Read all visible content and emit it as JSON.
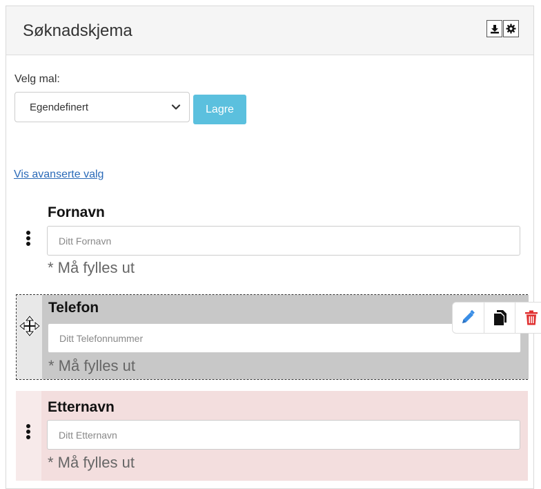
{
  "header": {
    "title": "Søknadskjema",
    "download_icon": "download-icon",
    "settings_icon": "gear-icon"
  },
  "template": {
    "label": "Velg mal:",
    "selected": "Egendefinert",
    "save_label": "Lagre"
  },
  "advanced_link": "Vis avanserte valg",
  "fields": [
    {
      "label": "Fornavn",
      "placeholder": "Ditt Fornavn",
      "required_text": "* Må fylles ut",
      "state": "normal"
    },
    {
      "label": "Telefon",
      "placeholder": "Ditt Telefonnummer",
      "required_text": "* Må fylles ut",
      "state": "dragging"
    },
    {
      "label": "Etternavn",
      "placeholder": "Ditt Etternavn",
      "required_text": "* Må fylles ut",
      "state": "highlighted"
    }
  ],
  "toolbar_icons": [
    "pencil-icon",
    "copy-icon",
    "trash-icon"
  ],
  "colors": {
    "accent_button": "#5bc0de",
    "link": "#2a6ab8",
    "edit_icon": "#3a8ee6",
    "delete_icon": "#e03030",
    "drag_bg": "#c8c8c8",
    "highlight_bg": "#f3dede"
  }
}
